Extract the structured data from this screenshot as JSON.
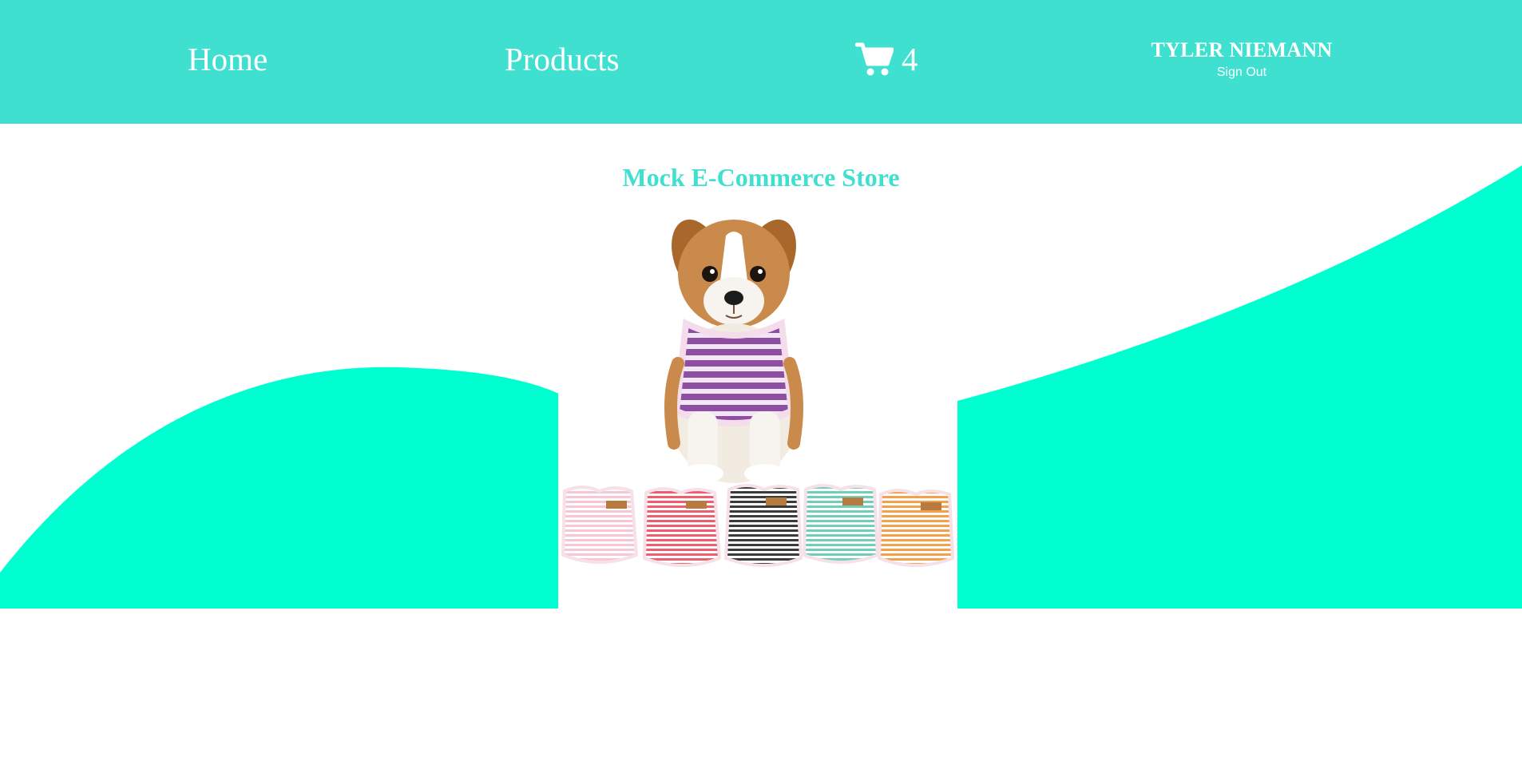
{
  "nav": {
    "home_label": "Home",
    "products_label": "Products",
    "cart_icon": "shopping-cart-icon",
    "cart_count": "4",
    "user_name": "TYLER NIEMANN",
    "sign_out_label": "Sign Out"
  },
  "main": {
    "title": "Mock E-Commerce Store",
    "hero_image": {
      "shirt_colors": [
        "#f9c6d3",
        "#ef5d6e",
        "#3a3a3a",
        "#6fcfb8",
        "#f7a04c"
      ],
      "vest_color": "#8e4fa3"
    }
  },
  "theme": {
    "nav_color": "#40e0d0",
    "wave_color": "#00ffd0",
    "title_color": "#40e0d0",
    "text_on_nav": "#ffffff"
  }
}
